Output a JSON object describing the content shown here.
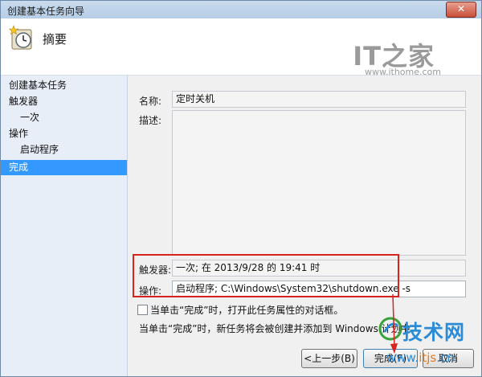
{
  "window": {
    "title": "创建基本任务向导",
    "close_label": "✕"
  },
  "header": {
    "title": "摘要",
    "icon": "task-scheduler-clock-icon"
  },
  "watermark": {
    "logo": "IT之家",
    "url": "www.ithome.com"
  },
  "sidebar": {
    "items": [
      {
        "label": "创建基本任务",
        "selected": false
      },
      {
        "label": "触发器",
        "selected": false
      },
      {
        "label": "一次",
        "selected": false
      },
      {
        "label": "操作",
        "selected": false
      },
      {
        "label": "启动程序",
        "selected": false
      },
      {
        "label": "完成",
        "selected": true
      }
    ]
  },
  "form": {
    "name_label": "名称:",
    "name_value": "定时关机",
    "desc_label": "描述:",
    "desc_value": "",
    "trigger_label": "触发器:",
    "trigger_value": "一次; 在 2013/9/28 的 19:41 时",
    "action_label": "操作:",
    "action_value": "启动程序; C:\\Windows\\System32\\shutdown.exe -s"
  },
  "checkbox": {
    "label": "当单击“完成”时，打开此任务属性的对话框。",
    "checked": false
  },
  "note": "当单击“完成”时，新任务将会被创建并添加到 Windows 计划中。",
  "buttons": {
    "back": "<上一步(B)",
    "finish": "完成(F)",
    "cancel": "取消"
  },
  "watermark2": {
    "text": "技术网",
    "url_prefix": "www.",
    "url_mid": "itjs",
    "url_suffix": ".cn"
  },
  "colors": {
    "selected_nav": "#3399ff",
    "highlight_border": "#d9231f",
    "sidebar_bg": "#e7eef7"
  }
}
